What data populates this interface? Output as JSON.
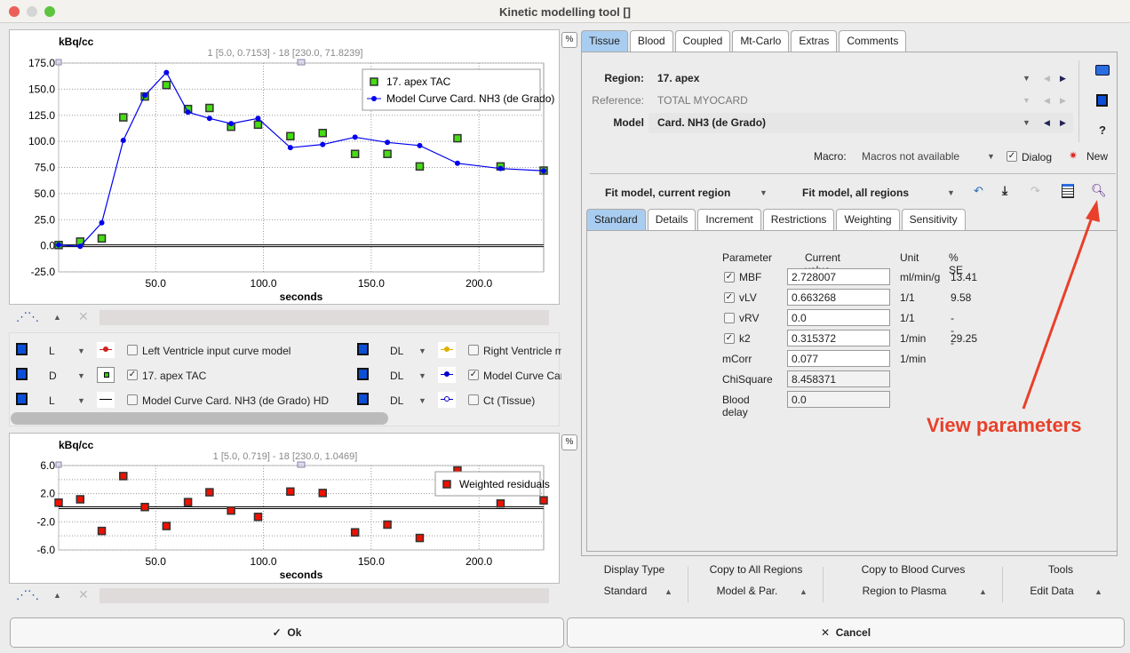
{
  "window": {
    "title": "Kinetic modelling tool []"
  },
  "top_chart": {
    "ylabel": "kBq/cc",
    "xlabel": "seconds",
    "header": "1 [5.0, 0.7153] - 18 [230.0, 71.8239]",
    "percent_button": "%"
  },
  "residual_chart": {
    "ylabel": "kBq/cc",
    "xlabel": "seconds",
    "header": "1 [5.0, 0.719] - 18 [230.0, 1.0469]",
    "percent_button": "%"
  },
  "curve_list": [
    {
      "mode": "L",
      "label": "Left Ventricle input curve model",
      "checked": false,
      "color": "#d02020"
    },
    {
      "mode": "DL",
      "label": "Right Ventricle m",
      "checked": false,
      "color": "#e0b000"
    },
    {
      "mode": "D",
      "label": "17. apex TAC",
      "checked": true,
      "color": "#33cc00"
    },
    {
      "mode": "DL",
      "label": "Model Curve Car",
      "checked": true,
      "color": "#0000cc"
    },
    {
      "mode": "L",
      "label": "Model Curve Card. NH3 (de Grado) HD",
      "checked": false,
      "color": "#000000"
    },
    {
      "mode": "DL",
      "label": "Ct (Tissue)",
      "checked": false,
      "color": "#0000cc"
    }
  ],
  "tabs": [
    "Tissue",
    "Blood",
    "Coupled",
    "Mt-Carlo",
    "Extras",
    "Comments"
  ],
  "tissue": {
    "region_label": "Region:",
    "region": "17. apex",
    "reference_label": "Reference:",
    "reference": "TOTAL MYOCARD",
    "model_label": "Model",
    "model": "Card. NH3 (de Grado)",
    "macro_label": "Macro:",
    "macro": "Macros not available",
    "dialog_label": "Dialog",
    "dialog_checked": true,
    "new_label": "New",
    "fit_current": "Fit model, current region",
    "fit_all": "Fit model, all regions",
    "subtabs": [
      "Standard",
      "Details",
      "Increment",
      "Restrictions",
      "Weighting",
      "Sensitivity"
    ],
    "param_headers": [
      "Parameter",
      "Current value",
      "Unit",
      "% SE"
    ],
    "params": [
      {
        "name": "MBF",
        "checkbox": true,
        "checked": true,
        "value": "2.728007",
        "unit": "ml/min/g",
        "se": "13.41"
      },
      {
        "name": "vLV",
        "checkbox": true,
        "checked": true,
        "value": "0.663268",
        "unit": "1/1",
        "se": "9.58"
      },
      {
        "name": "vRV",
        "checkbox": true,
        "checked": false,
        "value": "0.0",
        "unit": "1/1",
        "se": "---"
      },
      {
        "name": "k2",
        "checkbox": true,
        "checked": true,
        "value": "0.315372",
        "unit": "1/min",
        "se": "29.25"
      },
      {
        "name": "mCorr",
        "checkbox": false,
        "value": "0.077",
        "unit": "1/min",
        "se": ""
      },
      {
        "name": "ChiSquare",
        "checkbox": false,
        "value": "8.458371",
        "unit": "",
        "se": "",
        "readonly": true
      },
      {
        "name": "Blood delay",
        "checkbox": false,
        "value": "0.0",
        "unit": "",
        "se": "",
        "readonly": true
      }
    ]
  },
  "annotation": {
    "text": "View parameters",
    "color": "#e8402a"
  },
  "bottom_tools": [
    {
      "title": "Display Type",
      "value": "Standard"
    },
    {
      "title": "Copy to All Regions",
      "value": "Model & Par."
    },
    {
      "title": "Copy to Blood Curves",
      "value": "Region to Plasma"
    },
    {
      "title": "Tools",
      "value": "Edit Data"
    }
  ],
  "buttons": {
    "ok": "Ok",
    "cancel": "Cancel"
  },
  "chart_data": [
    {
      "type": "scatter",
      "ylabel": "kBq/cc",
      "xlabel": "seconds",
      "xlim": [
        5,
        230
      ],
      "ylim": [
        -25,
        175
      ],
      "xticks": [
        50,
        100,
        150,
        200
      ],
      "yticks": [
        -25,
        0,
        25,
        50,
        75,
        100,
        125,
        150,
        175
      ],
      "grid": true,
      "legend": "top-right",
      "x": [
        5,
        15,
        25,
        35,
        45,
        55,
        65,
        75,
        85,
        97.5,
        112.5,
        127.5,
        142.5,
        157.5,
        172.5,
        190,
        210,
        230
      ],
      "series": [
        {
          "name": "17. apex TAC",
          "type": "scatter",
          "color": "#44dd11",
          "values": [
            0.7,
            4,
            7,
            123,
            143,
            154,
            131,
            132,
            114,
            116,
            105,
            108,
            88,
            88,
            76,
            103,
            76,
            72
          ]
        },
        {
          "name": "Model Curve Card. NH3 (de Grado)",
          "type": "line",
          "color": "#0000ee",
          "values": [
            0.7,
            -0.5,
            22,
            101,
            144,
            166,
            128,
            122,
            117,
            122,
            94,
            97,
            104,
            99,
            96,
            79,
            74,
            71.8
          ]
        }
      ]
    },
    {
      "type": "scatter",
      "ylabel": "kBq/cc",
      "xlabel": "seconds",
      "xlim": [
        5,
        230
      ],
      "ylim": [
        -6,
        6
      ],
      "xticks": [
        50,
        100,
        150,
        200
      ],
      "yticks": [
        -6,
        -2,
        2,
        6
      ],
      "grid": true,
      "legend": "top-right",
      "x": [
        5,
        15,
        25,
        35,
        45,
        55,
        65,
        75,
        85,
        97.5,
        112.5,
        127.5,
        142.5,
        157.5,
        172.5,
        190,
        210,
        230
      ],
      "series": [
        {
          "name": "Weighted residuals",
          "type": "scatter",
          "color": "#ee1100",
          "values": [
            0.72,
            1.2,
            -3.3,
            4.5,
            0.1,
            -2.6,
            0.8,
            2.2,
            -0.4,
            -1.3,
            2.3,
            2.1,
            -3.5,
            -2.4,
            -4.3,
            5.3,
            0.6,
            1.05
          ]
        }
      ]
    }
  ]
}
